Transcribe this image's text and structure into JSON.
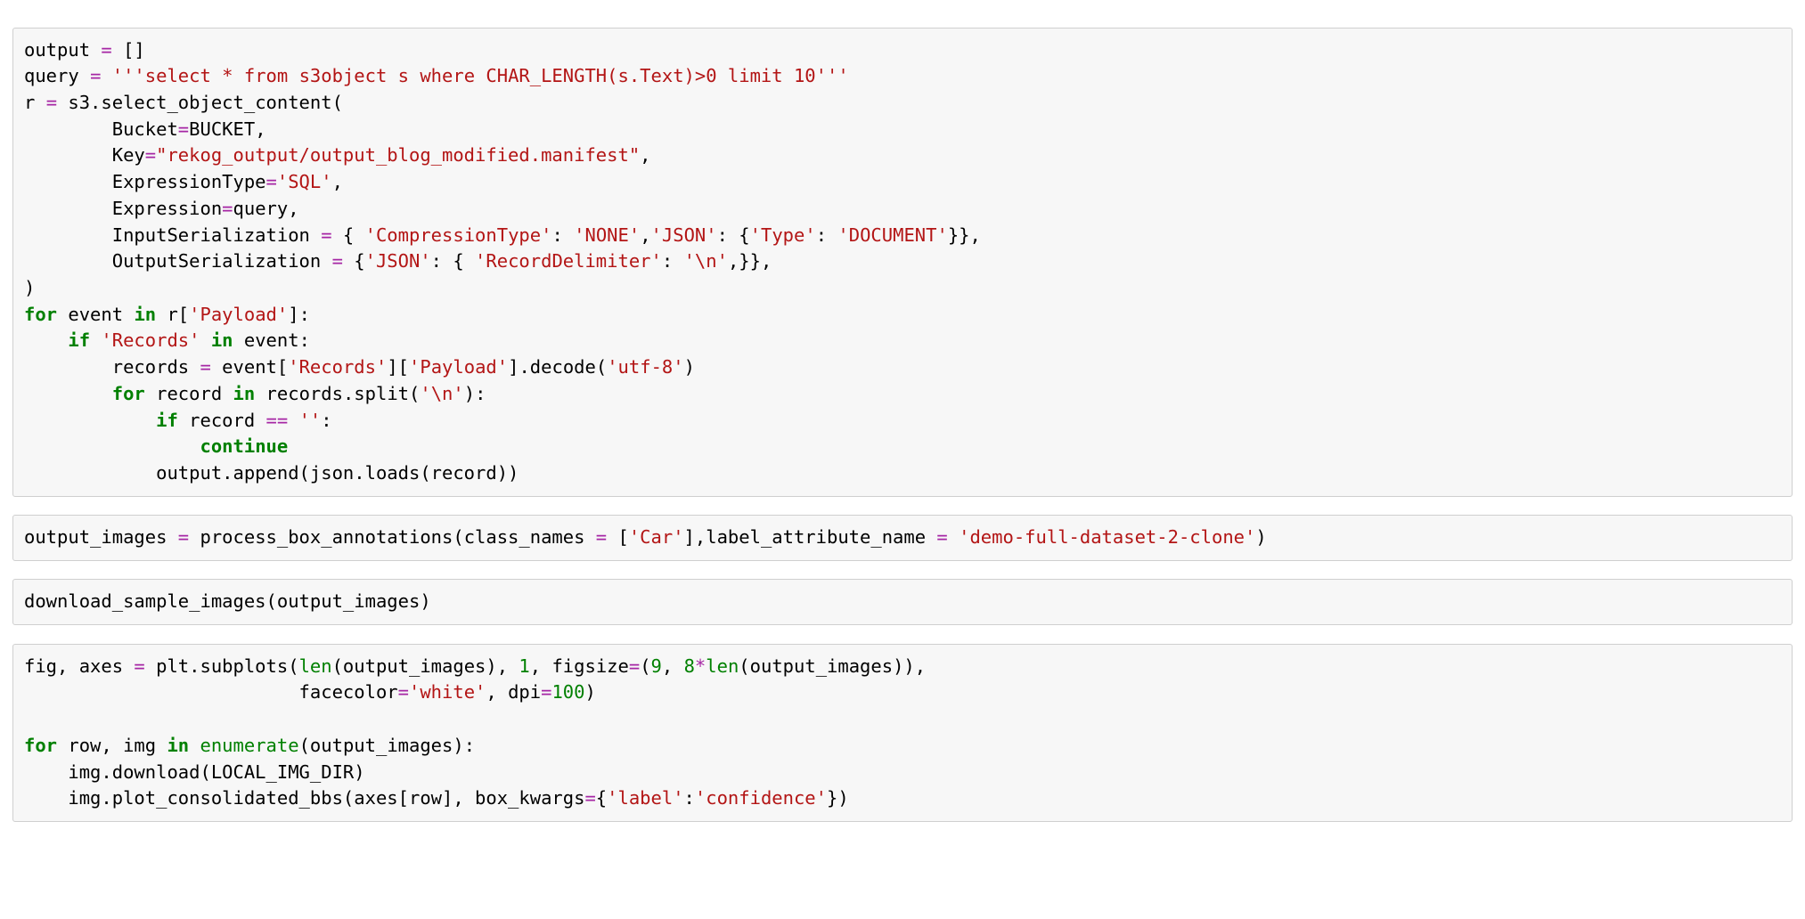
{
  "cells": [
    {
      "id": "cell1",
      "tokens": [
        [
          [
            "n",
            "output "
          ],
          [
            "op",
            "="
          ],
          [
            "n",
            " []"
          ]
        ],
        [
          [
            "n",
            "query "
          ],
          [
            "op",
            "="
          ],
          [
            "n",
            " "
          ],
          [
            "s",
            "'''select * from s3object s where CHAR_LENGTH(s.Text)>0 limit 10'''"
          ]
        ],
        [
          [
            "n",
            "r "
          ],
          [
            "op",
            "="
          ],
          [
            "n",
            " s3.select_object_content("
          ]
        ],
        [
          [
            "n",
            "        Bucket"
          ],
          [
            "op",
            "="
          ],
          [
            "n",
            "BUCKET,"
          ]
        ],
        [
          [
            "n",
            "        Key"
          ],
          [
            "op",
            "="
          ],
          [
            "s",
            "\"rekog_output/output_blog_modified.manifest\""
          ],
          [
            "n",
            ","
          ]
        ],
        [
          [
            "n",
            "        ExpressionType"
          ],
          [
            "op",
            "="
          ],
          [
            "s",
            "'SQL'"
          ],
          [
            "n",
            ","
          ]
        ],
        [
          [
            "n",
            "        Expression"
          ],
          [
            "op",
            "="
          ],
          [
            "n",
            "query,"
          ]
        ],
        [
          [
            "n",
            "        InputSerialization "
          ],
          [
            "op",
            "="
          ],
          [
            "n",
            " { "
          ],
          [
            "s",
            "'CompressionType'"
          ],
          [
            "n",
            ": "
          ],
          [
            "s",
            "'NONE'"
          ],
          [
            "n",
            ","
          ],
          [
            "s",
            "'JSON'"
          ],
          [
            "n",
            ": {"
          ],
          [
            "s",
            "'Type'"
          ],
          [
            "n",
            ": "
          ],
          [
            "s",
            "'DOCUMENT'"
          ],
          [
            "n",
            "}},"
          ]
        ],
        [
          [
            "n",
            "        OutputSerialization "
          ],
          [
            "op",
            "="
          ],
          [
            "n",
            " {"
          ],
          [
            "s",
            "'JSON'"
          ],
          [
            "n",
            ": { "
          ],
          [
            "s",
            "'RecordDelimiter'"
          ],
          [
            "n",
            ": "
          ],
          [
            "s",
            "'\\n'"
          ],
          [
            "n",
            ",}},"
          ]
        ],
        [
          [
            "n",
            ")"
          ]
        ],
        [
          [
            "k",
            "for"
          ],
          [
            "n",
            " event "
          ],
          [
            "k",
            "in"
          ],
          [
            "n",
            " r["
          ],
          [
            "s",
            "'Payload'"
          ],
          [
            "n",
            "]:"
          ]
        ],
        [
          [
            "n",
            "    "
          ],
          [
            "k",
            "if"
          ],
          [
            "n",
            " "
          ],
          [
            "s",
            "'Records'"
          ],
          [
            "n",
            " "
          ],
          [
            "k",
            "in"
          ],
          [
            "n",
            " event:"
          ]
        ],
        [
          [
            "n",
            "        records "
          ],
          [
            "op",
            "="
          ],
          [
            "n",
            " event["
          ],
          [
            "s",
            "'Records'"
          ],
          [
            "n",
            "]["
          ],
          [
            "s",
            "'Payload'"
          ],
          [
            "n",
            "].decode("
          ],
          [
            "s",
            "'utf-8'"
          ],
          [
            "n",
            ")"
          ]
        ],
        [
          [
            "n",
            "        "
          ],
          [
            "k",
            "for"
          ],
          [
            "n",
            " record "
          ],
          [
            "k",
            "in"
          ],
          [
            "n",
            " records.split("
          ],
          [
            "s",
            "'\\n'"
          ],
          [
            "n",
            "):"
          ]
        ],
        [
          [
            "n",
            "            "
          ],
          [
            "k",
            "if"
          ],
          [
            "n",
            " record "
          ],
          [
            "op",
            "=="
          ],
          [
            "n",
            " "
          ],
          [
            "s",
            "''"
          ],
          [
            "n",
            ":"
          ]
        ],
        [
          [
            "n",
            "                "
          ],
          [
            "k",
            "continue"
          ]
        ],
        [
          [
            "n",
            "            output.append(json.loads(record))"
          ]
        ]
      ]
    },
    {
      "id": "cell2",
      "tokens": [
        [
          [
            "n",
            "output_images "
          ],
          [
            "op",
            "="
          ],
          [
            "n",
            " process_box_annotations(class_names "
          ],
          [
            "op",
            "="
          ],
          [
            "n",
            " ["
          ],
          [
            "s",
            "'Car'"
          ],
          [
            "n",
            "],label_attribute_name "
          ],
          [
            "op",
            "="
          ],
          [
            "n",
            " "
          ],
          [
            "s",
            "'demo-full-dataset-2-clone'"
          ],
          [
            "n",
            ")"
          ]
        ]
      ]
    },
    {
      "id": "cell3",
      "tokens": [
        [
          [
            "n",
            "download_sample_images(output_images)"
          ]
        ]
      ]
    },
    {
      "id": "cell4",
      "tokens": [
        [
          [
            "n",
            "fig, axes "
          ],
          [
            "op",
            "="
          ],
          [
            "n",
            " plt.subplots("
          ],
          [
            "b",
            "len"
          ],
          [
            "n",
            "(output_images), "
          ],
          [
            "num",
            "1"
          ],
          [
            "n",
            ", figsize"
          ],
          [
            "op",
            "="
          ],
          [
            "n",
            "("
          ],
          [
            "num",
            "9"
          ],
          [
            "n",
            ", "
          ],
          [
            "num",
            "8"
          ],
          [
            "op",
            "*"
          ],
          [
            "b",
            "len"
          ],
          [
            "n",
            "(output_images)),"
          ]
        ],
        [
          [
            "n",
            "                         facecolor"
          ],
          [
            "op",
            "="
          ],
          [
            "s",
            "'white'"
          ],
          [
            "n",
            ", dpi"
          ],
          [
            "op",
            "="
          ],
          [
            "num",
            "100"
          ],
          [
            "n",
            ")"
          ]
        ],
        [
          [
            "n",
            ""
          ]
        ],
        [
          [
            "k",
            "for"
          ],
          [
            "n",
            " row, img "
          ],
          [
            "k",
            "in"
          ],
          [
            "n",
            " "
          ],
          [
            "b",
            "enumerate"
          ],
          [
            "n",
            "(output_images):"
          ]
        ],
        [
          [
            "n",
            "    img.download(LOCAL_IMG_DIR)"
          ]
        ],
        [
          [
            "n",
            "    img.plot_consolidated_bbs(axes[row], box_kwargs"
          ],
          [
            "op",
            "="
          ],
          [
            "n",
            "{"
          ],
          [
            "s",
            "'label'"
          ],
          [
            "n",
            ":"
          ],
          [
            "s",
            "'confidence'"
          ],
          [
            "n",
            "})"
          ]
        ]
      ]
    }
  ]
}
